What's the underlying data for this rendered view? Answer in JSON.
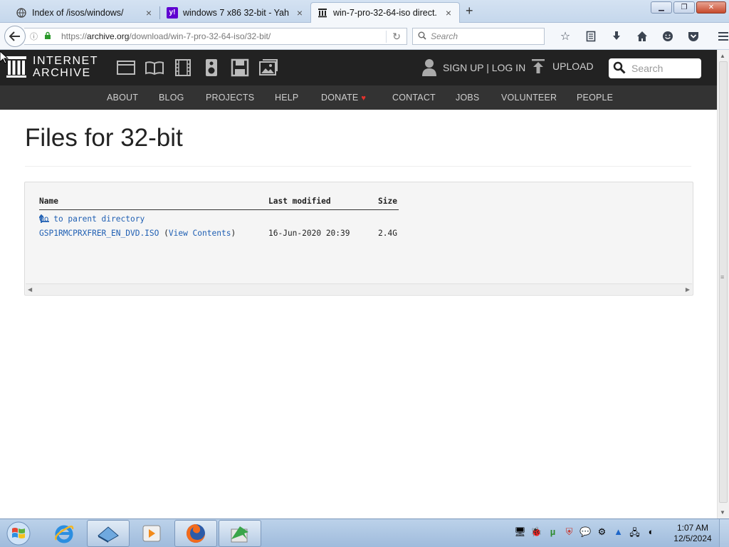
{
  "browser": {
    "tabs": [
      {
        "title": "Index of /isos/windows/",
        "icon": "globe-icon",
        "active": false
      },
      {
        "title": "windows 7 x86 32-bit - Yah...",
        "icon": "yahoo-icon",
        "active": false
      },
      {
        "title": "win-7-pro-32-64-iso direct...",
        "icon": "archive-icon",
        "active": true
      }
    ],
    "url_prefix": "https://",
    "url_domain": "archive.org",
    "url_path": "/download/win-7-pro-32-64-iso/32-bit/",
    "search_placeholder": "Search"
  },
  "ia_header": {
    "logo_line1": "INTERNET",
    "logo_line2": "ARCHIVE",
    "signup_login": "SIGN UP | LOG IN",
    "upload": "UPLOAD",
    "search_placeholder": "Search",
    "nav": [
      "ABOUT",
      "BLOG",
      "PROJECTS",
      "HELP",
      "DONATE",
      "CONTACT",
      "JOBS",
      "VOLUNTEER",
      "PEOPLE"
    ]
  },
  "content": {
    "title": "Files for 32-bit",
    "columns": {
      "name": "Name",
      "modified": "Last modified",
      "size": "Size"
    },
    "parent_link": "Go to parent directory",
    "files": [
      {
        "name": "GSP1RMCPRXFRER_EN_DVD.ISO",
        "view_contents": "View Contents",
        "modified": "16-Jun-2020 20:39",
        "size": "2.4G"
      }
    ]
  },
  "taskbar": {
    "time": "1:07 AM",
    "date": "12/5/2024"
  },
  "colors": {
    "ia_header_bg": "#222222",
    "ia_nav_bg": "#333333",
    "link": "#1f5fb3",
    "donate_heart": "#e3322c"
  }
}
